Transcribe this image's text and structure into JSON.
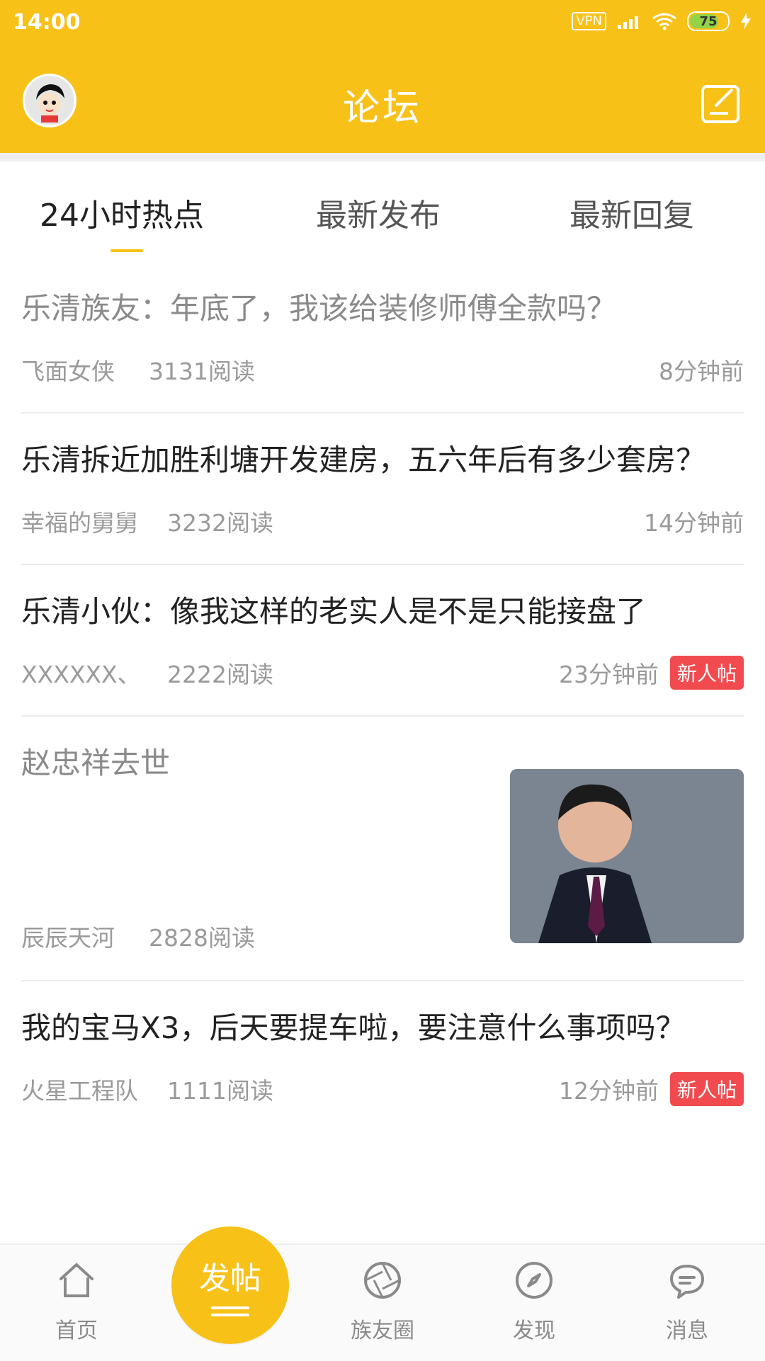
{
  "status_bar": {
    "time": "14:00",
    "vpn": "VPN",
    "battery_level": "75"
  },
  "header": {
    "title": "论坛"
  },
  "tabs": [
    {
      "label": "24小时热点",
      "active": true
    },
    {
      "label": "最新发布",
      "active": false
    },
    {
      "label": "最新回复",
      "active": false
    }
  ],
  "posts": [
    {
      "title": "乐清族友：年底了，我该给装修师傅全款吗？",
      "author": "飞面女侠",
      "reads": "3131阅读",
      "time": "8分钟前"
    },
    {
      "title": "乐清拆近加胜利塘开发建房，五六年后有多少套房？",
      "author": "幸福的舅舅",
      "reads": "3232阅读",
      "time": "14分钟前"
    },
    {
      "title": "乐清小伙：像我这样的老实人是不是只能接盘了",
      "author": "XXXXXX、",
      "reads": "2222阅读",
      "time": "23分钟前",
      "badge": "新人帖"
    },
    {
      "title": "赵忠祥去世",
      "author": "辰辰天河",
      "reads": "2828阅读"
    },
    {
      "title": "我的宝马X3，后天要提车啦，要注意什么事项吗？",
      "author": "火星工程队",
      "reads": "1111阅读",
      "time": "12分钟前",
      "badge": "新人帖"
    }
  ],
  "bottom_nav": {
    "home": "首页",
    "post": "发帖",
    "circle": "族友圈",
    "discover": "发现",
    "messages": "消息"
  },
  "colors": {
    "brand": "#F7C118",
    "badge": "#F14B50"
  }
}
